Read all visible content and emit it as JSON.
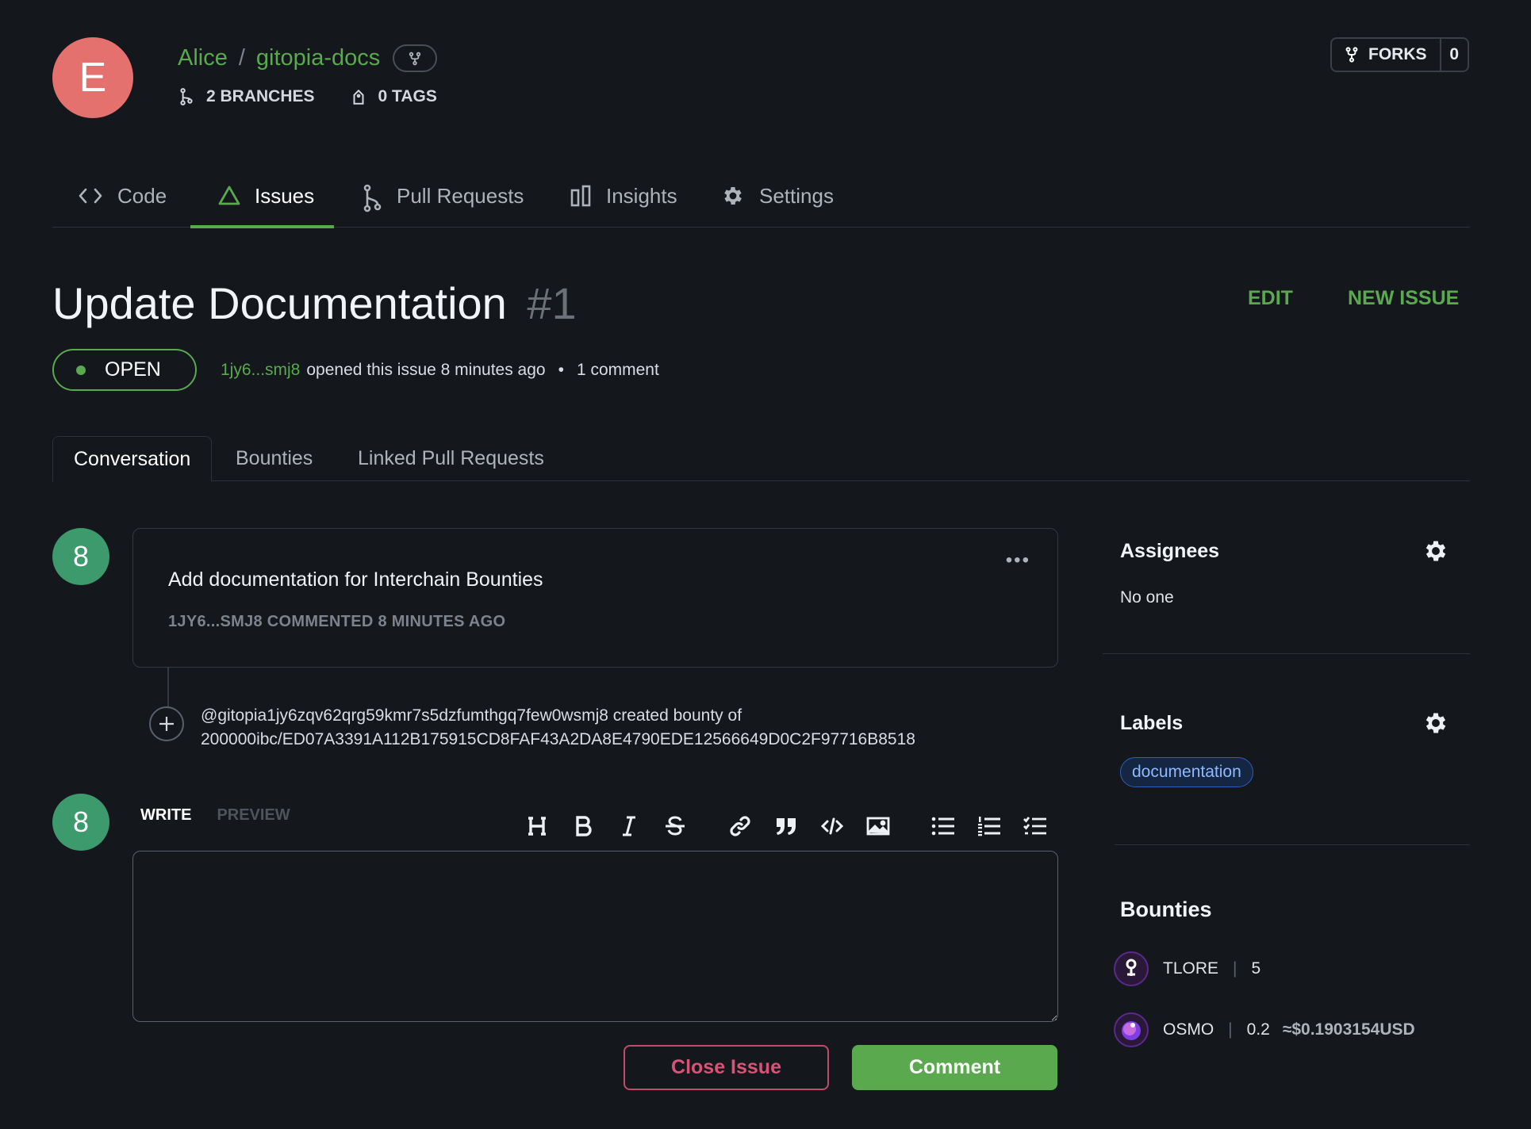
{
  "repo": {
    "avatar_letter": "E",
    "owner": "Alice",
    "separator": "/",
    "name": "gitopia-docs",
    "branches": "2 BRANCHES",
    "tags": "0 TAGS",
    "forks_label": "FORKS",
    "forks_count": "0"
  },
  "nav": {
    "tabs": [
      {
        "label": "Code",
        "icon": "code-icon"
      },
      {
        "label": "Issues",
        "icon": "issues-icon",
        "active": true
      },
      {
        "label": "Pull Requests",
        "icon": "pull-request-icon"
      },
      {
        "label": "Insights",
        "icon": "insights-icon"
      },
      {
        "label": "Settings",
        "icon": "gear-icon"
      }
    ]
  },
  "issue": {
    "title": "Update Documentation",
    "number": "#1",
    "edit_label": "EDIT",
    "new_issue_label": "NEW ISSUE",
    "status": "OPEN",
    "author": "1jy6...smj8",
    "opened_text": "opened this issue 8 minutes ago",
    "bullet": "•",
    "comments": "1 comment"
  },
  "subtabs": [
    "Conversation",
    "Bounties",
    "Linked Pull Requests"
  ],
  "comment": {
    "avatar_text": "8",
    "body": "Add documentation for Interchain Bounties",
    "meta": "1JY6...SMJ8 COMMENTED 8 MINUTES AGO",
    "more": "•••"
  },
  "event": {
    "line1": "@gitopia1jy6zqv62qrg59kmr7s5dzfumthgq7few0wsmj8 created bounty of",
    "line2": "200000ibc/ED07A3391A112B175915CD8FAF43A2DA8E4790EDE12566649D0C2F97716B8518"
  },
  "editor": {
    "avatar_text": "8",
    "write_label": "WRITE",
    "preview_label": "PREVIEW",
    "tools": [
      "heading-icon",
      "bold-icon",
      "italic-icon",
      "strikethrough-icon",
      "link-icon",
      "quote-icon",
      "code-icon",
      "image-icon",
      "bullet-list-icon",
      "numbered-list-icon",
      "task-list-icon"
    ],
    "close_label": "Close Issue",
    "comment_label": "Comment"
  },
  "sidebar": {
    "assignees_title": "Assignees",
    "assignees_value": "No one",
    "labels_title": "Labels",
    "labels": [
      "documentation"
    ],
    "bounties_title": "Bounties",
    "bounties": [
      {
        "token": "TLORE",
        "amount": "5",
        "usd": ""
      },
      {
        "token": "OSMO",
        "amount": "0.2",
        "usd": "≈$0.1903154USD"
      }
    ],
    "vbar": "|"
  },
  "colors": {
    "accent": "#5aa94f",
    "background": "#14171c",
    "avatar": "#e5716e",
    "comment_avatar": "#3d9a6c",
    "danger": "#d95378"
  }
}
